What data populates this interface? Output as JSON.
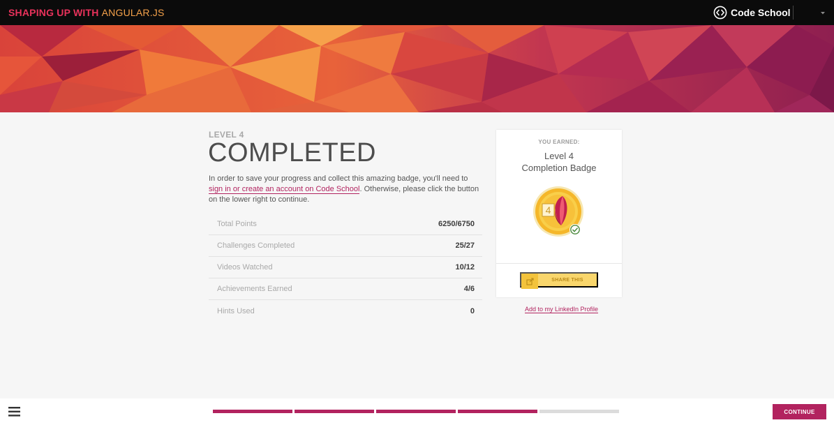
{
  "header": {
    "course_title_part1": "SHAPING UP WITH ",
    "course_title_part2": "ANGULAR.JS",
    "brand_name": "Code School",
    "brand_logo_icon": "code-school-logo-icon",
    "menu_caret_icon": "caret-down-icon"
  },
  "main": {
    "level_label": "LEVEL 4",
    "title": "COMPLETED",
    "intro": {
      "text_before": "In order to save your progress and collect this amazing badge, you'll need to ",
      "link_text": "sign in or create an account on Code School",
      "text_after": ". Otherwise, please click the button on the lower right to continue."
    },
    "stats": [
      {
        "label": "Total Points",
        "value": "6250/6750"
      },
      {
        "label": "Challenges Completed",
        "value": "25/27"
      },
      {
        "label": "Videos Watched",
        "value": "10/12"
      },
      {
        "label": "Achievements Earned",
        "value": "4/6"
      },
      {
        "label": "Hints Used",
        "value": "0"
      }
    ]
  },
  "badge_card": {
    "earned_label": "YOU EARNED:",
    "badge_title_line1": "Level 4",
    "badge_title_line2": "Completion Badge",
    "badge_icon": "level-4-completion-badge-icon",
    "share_label": "SHARE THIS",
    "share_icon": "share-icon",
    "linkedin_link": "Add to my LinkedIn Profile"
  },
  "footer": {
    "menu_icon": "hamburger-menu-icon",
    "progress": {
      "completed_segments": 4,
      "total_segments": 5
    },
    "continue_label": "CONTINUE"
  },
  "colors": {
    "accent": "#b2235f",
    "topbar": "#0b0b0b",
    "course_title": "#e8325b",
    "share_button": "#f9d66c",
    "background": "#f6f6f6"
  }
}
